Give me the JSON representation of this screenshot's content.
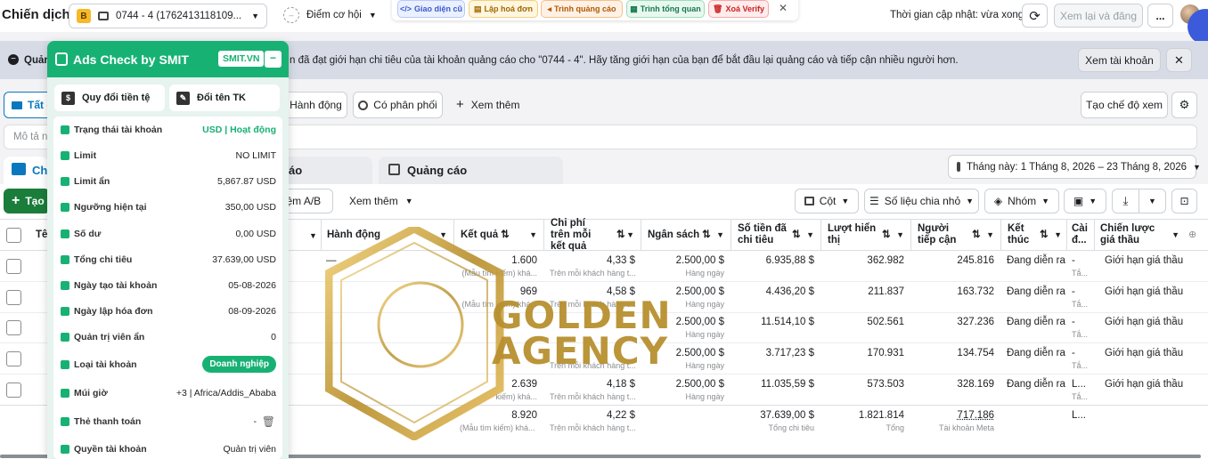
{
  "topbar": {
    "title": "Chiến dịch",
    "account_badge": "B",
    "account_selector": "0744 - 4 (1762413118109...",
    "opportunity_label": "Điểm cơ hội",
    "ext_buttons": [
      "Giao diện cũ",
      "Lập hoá đơn",
      "Trình quảng cáo",
      "Trình tổng quan",
      "Xoá Verify"
    ],
    "updated_text": "Thời gian cập nhật: vừa xong",
    "review_publish": "Xem lại và đăng",
    "more": "..."
  },
  "banner": {
    "prefix": "Quản",
    "text": "n đã đạt giới hạn chi tiêu của tài khoản quảng cáo cho \"0744 - 4\". Hãy tăng giới hạn của bạn để bắt đầu lại quảng cáo và tiếp cận nhiều người hơn.",
    "view_account": "Xem tài khoản"
  },
  "filters": {
    "all_tab": "Tất c",
    "action": "Hành động",
    "distributed": "Có phân phối",
    "more": "Xem thêm",
    "create_view": "Tạo chế độ xem",
    "search_placeholder": "Mô tả nh"
  },
  "level_tabs": {
    "campaigns": "Chi",
    "adsets": "áo",
    "ads": "Quảng cáo",
    "date_range": "Tháng này: 1 Tháng 8, 2026 – 23 Tháng 8, 2026"
  },
  "toolbar": {
    "create": "Tạo",
    "ab_test": "iệm A/B",
    "more": "Xem thêm",
    "columns": "Cột",
    "breakdown": "Số liệu chia nhỏ",
    "group": "Nhóm"
  },
  "table": {
    "headers": {
      "name": "Tê",
      "action": "Hành động",
      "results": "Kết quả",
      "cost_per_result": "Chi phí trên mỗi kết quả",
      "budget": "Ngân sách",
      "spent": "Số tiền đã chi tiêu",
      "impressions": "Lượt hiển thị",
      "reach": "Người tiếp cận",
      "ends": "Kết thúc",
      "settings": "Cài đ...",
      "bid_strategy": "Chiến lược giá thầu"
    },
    "rows": [
      {
        "action": "—",
        "results": "1.600",
        "results_sub": "(Mẫu tìm kiếm) khá...",
        "cpr": "4,33 $",
        "cpr_sub": "Trên mỗi khách hàng t...",
        "budget": "2.500,00 $",
        "budget_sub": "Hàng ngày",
        "spent": "6.935,88 $",
        "impr": "362.982",
        "reach": "245.816",
        "end": "Đang diễn ra",
        "setting": "-",
        "setting_sub": "Tắ...",
        "bid": "Giới hạn giá thầu"
      },
      {
        "action": "",
        "results": "969",
        "results_sub": "(Mẫu tìm kiếm) khá...",
        "cpr": "4,58 $",
        "cpr_sub": "Trên mỗi khách hàng t...",
        "budget": "2.500,00 $",
        "budget_sub": "Hàng ngày",
        "spent": "4.436,20 $",
        "impr": "211.837",
        "reach": "163.732",
        "end": "Đang diễn ra",
        "setting": "-",
        "setting_sub": "Tắ...",
        "bid": "Giới hạn giá thầu"
      },
      {
        "action": "",
        "results": "",
        "results_sub": "",
        "cpr": "",
        "cpr_sub": "",
        "budget": "2.500,00 $",
        "budget_sub": "Hàng ngày",
        "spent": "11.514,10 $",
        "impr": "502.561",
        "reach": "327.236",
        "end": "Đang diễn ra",
        "setting": "-",
        "setting_sub": "Tắ...",
        "bid": "Giới hạn giá thầu"
      },
      {
        "action": "",
        "results": "",
        "results_sub": "",
        "cpr": "",
        "cpr_sub": "Trên mỗi khách hàng t...",
        "budget": "2.500,00 $",
        "budget_sub": "Hàng ngày",
        "spent": "3.717,23 $",
        "impr": "170.931",
        "reach": "134.754",
        "end": "Đang diễn ra",
        "setting": "-",
        "setting_sub": "Tắ...",
        "bid": "Giới hạn giá thầu"
      },
      {
        "action": "",
        "results": "2.639",
        "results_sub": "kiếm) khá...",
        "cpr": "4,18 $",
        "cpr_sub": "Trên mỗi khách hàng t...",
        "budget": "2.500,00 $",
        "budget_sub": "Hàng ngày",
        "spent": "11.035,59 $",
        "impr": "573.503",
        "reach": "328.169",
        "end": "Đang diễn ra",
        "setting": "L...",
        "setting_sub": "Tắ...",
        "bid": "Giới hạn giá thầu"
      }
    ],
    "totals": {
      "results": "8.920",
      "results_sub": "(Mẫu tìm kiếm) khá...",
      "cpr": "4,22 $",
      "cpr_sub": "Trên mỗi khách hàng t...",
      "spent": "37.639,00 $",
      "spent_sub": "Tổng chi tiêu",
      "impr": "1.821.814",
      "impr_sub": "Tổng",
      "reach": "717.186",
      "reach_sub": "Tài khoản Meta",
      "setting": "L..."
    }
  },
  "watermark": {
    "line1": "GOLDEN",
    "line2": "AGENCY"
  },
  "panel": {
    "title": "Ads Check by SMIT",
    "badge": "SMIT.VN",
    "btn_convert": "Quy đổi tiền tệ",
    "btn_rename": "Đổi tên TK",
    "rows": [
      {
        "label": "Trạng thái tài khoản",
        "value": "USD | Hoạt động"
      },
      {
        "label": "Limit",
        "value": "NO LIMIT"
      },
      {
        "label": "Limit ẩn",
        "value": "5,867.87 USD"
      },
      {
        "label": "Ngưỡng hiện tại",
        "value": "350,00 USD"
      },
      {
        "label": "Số dư",
        "value": "0,00 USD"
      },
      {
        "label": "Tổng chi tiêu",
        "value": "37.639,00 USD"
      },
      {
        "label": "Ngày tạo tài khoản",
        "value": "05-08-2026"
      },
      {
        "label": "Ngày lập hóa đơn",
        "value": "08-09-2026"
      },
      {
        "label": "Quản trị viên ẩn",
        "value": "0"
      },
      {
        "label": "Loại tài khoản",
        "value": "Doanh nghiệp"
      },
      {
        "label": "Múi giờ",
        "value": "+3 | Africa/Addis_Ababa"
      },
      {
        "label": "Thẻ thanh toán",
        "value": "-"
      },
      {
        "label": "Quyền tài khoản",
        "value": "Quản trị viên"
      }
    ]
  },
  "colors": {
    "accent": "#0a78be",
    "green": "#18b174",
    "gold": "#b8902f"
  }
}
